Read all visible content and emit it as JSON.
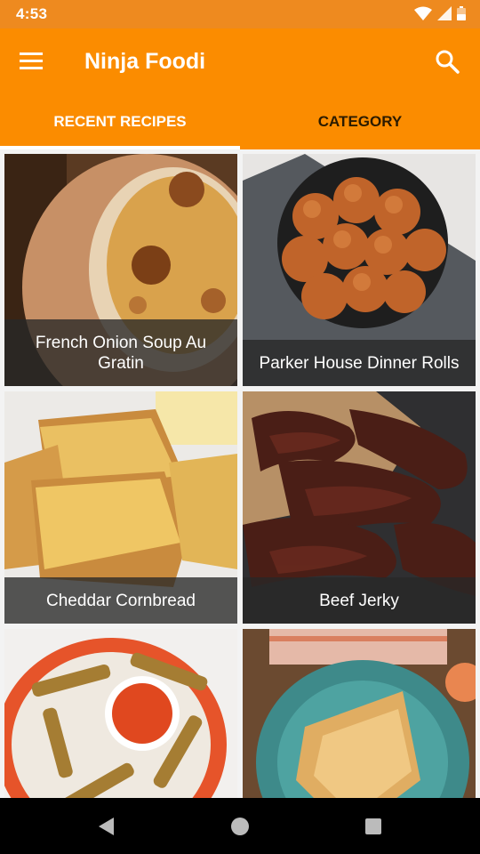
{
  "status_bar": {
    "time": "4:53"
  },
  "app_bar": {
    "title": "Ninja Foodi",
    "menu_icon": "menu-icon",
    "search_icon": "search-icon"
  },
  "tabs": [
    {
      "label": "RECENT RECIPES",
      "active": true
    },
    {
      "label": "CATEGORY",
      "active": false
    }
  ],
  "recipes": [
    {
      "title": "French Onion Soup Au Gratin"
    },
    {
      "title": "Parker House Dinner Rolls"
    },
    {
      "title": "Cheddar Cornbread"
    },
    {
      "title": "Beef Jerky"
    },
    {
      "title": ""
    },
    {
      "title": ""
    }
  ],
  "colors": {
    "primary": "#fb8c00",
    "status_bar": "#ee8a1f",
    "tab_indicator": "#ffffff",
    "inactive_tab_text": "#2b1b00"
  }
}
